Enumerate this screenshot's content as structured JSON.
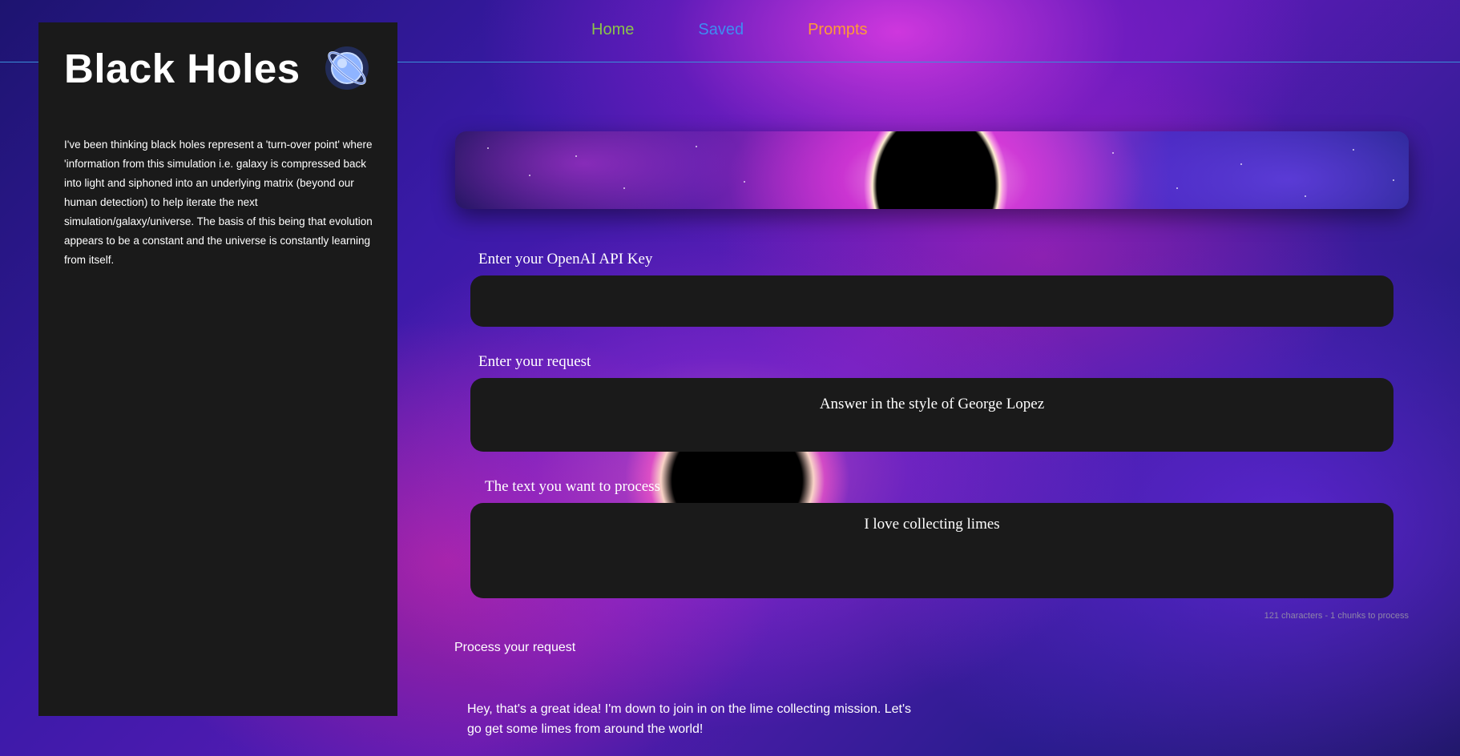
{
  "nav": {
    "items": [
      {
        "label": "Home",
        "color": "#8bc34a"
      },
      {
        "label": "Saved",
        "color": "#3f8cf2"
      },
      {
        "label": "Prompts",
        "color": "#ff9a36"
      }
    ]
  },
  "sidebar": {
    "title": "Black Holes",
    "icon": "planet-icon",
    "description": "I've been thinking black holes represent a 'turn-over point' where 'information from this simulation i.e. galaxy is compressed back into light and siphoned into an underlying matrix (beyond our human detection) to help iterate the next simulation/galaxy/universe. The basis of this being that evolution appears to be a constant and the universe is constantly learning from itself."
  },
  "form": {
    "api_key_label": "Enter your OpenAI API Key",
    "api_key_value": "",
    "request_label": "Enter your request",
    "request_value": "Answer in the style of George Lopez",
    "text_label": "The text you want to process",
    "text_value": "I love collecting limes",
    "counter": "121 characters - 1 chunks to process",
    "process_label": "Process your request"
  },
  "response": {
    "text": "Hey, that's a great idea! I'm down to join in on the lime collecting mission. Let's go get some limes from around the world!"
  }
}
